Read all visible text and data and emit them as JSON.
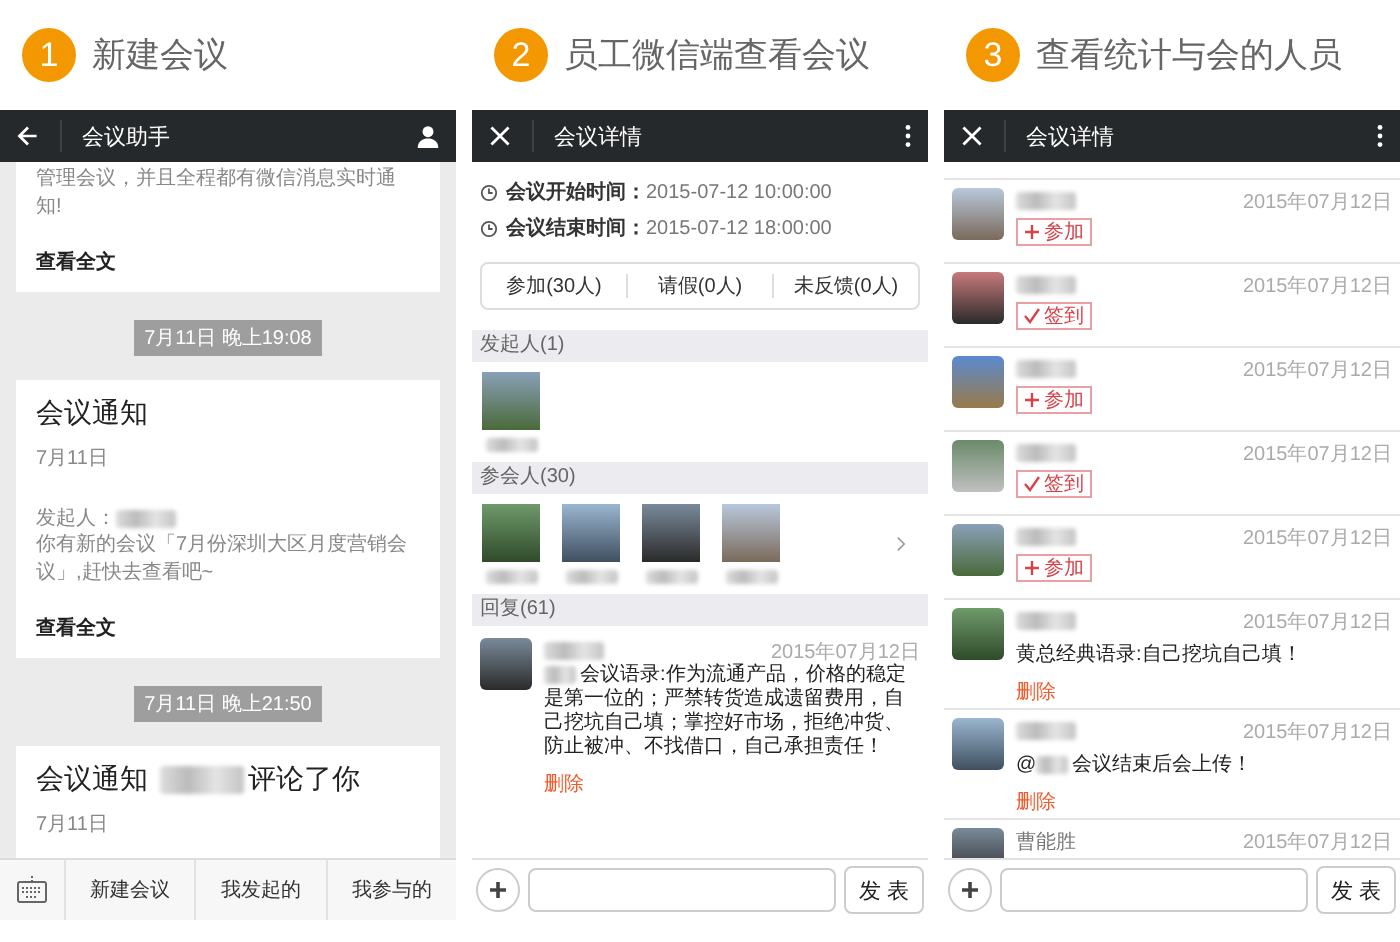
{
  "steps": [
    {
      "number": "1",
      "title": "新建会议"
    },
    {
      "number": "2",
      "title": "员工微信端查看会议"
    },
    {
      "number": "3",
      "title": "查看统计与会的人员"
    }
  ],
  "panel_1": {
    "header": {
      "title": "会议助手"
    },
    "feed": [
      {
        "kind": "card",
        "body": "管理会议，并且全程都有微信消息实时通知!",
        "link": "查看全文"
      },
      {
        "kind": "time",
        "text": "7月11日 晚上19:08"
      },
      {
        "kind": "card",
        "title": "会议通知",
        "date": "7月11日",
        "sender_label": "发起人：",
        "body": "你有新的会议「7月份深圳大区月度营销会议」,赶快去查看吧~",
        "link": "查看全文"
      },
      {
        "kind": "time",
        "text": "7月11日 晚上21:50"
      },
      {
        "kind": "card",
        "title": "会议通知",
        "title_suffix": "评论了你",
        "date": "7月11日"
      }
    ],
    "menu": [
      "新建会议",
      "我发起的",
      "我参与的"
    ]
  },
  "panel_2": {
    "header": {
      "title": "会议详情"
    },
    "times": [
      {
        "label": "会议开始时间：",
        "value": "2015-07-12 10:00:00"
      },
      {
        "label": "会议结束时间：",
        "value": "2015-07-12 18:00:00"
      }
    ],
    "response_counts": [
      "参加(30人)",
      "请假(0人)",
      "未反馈(0人)"
    ],
    "organizer_heading": "发起人(1)",
    "attendees_heading": "参会人(30)",
    "replies": {
      "heading": "回复(61)",
      "items": [
        {
          "date": "2015年07月12日",
          "text": "会议语录:作为流通产品，价格的稳定是第一位的；严禁转货造成遗留费用，自己挖坑自己填；掌控好市场，拒绝冲货、防止被冲、不找借口，自己承担责任！",
          "action": "删除"
        }
      ]
    },
    "composer": {
      "button": "发 表"
    }
  },
  "panel_3": {
    "header": {
      "title": "会议详情"
    },
    "entries": [
      {
        "kind": "join",
        "label": "参加",
        "date": "2015年07月12日"
      },
      {
        "kind": "checkin",
        "label": "签到",
        "date": "2015年07月12日"
      },
      {
        "kind": "join",
        "label": "参加",
        "date": "2015年07月12日"
      },
      {
        "kind": "checkin",
        "label": "签到",
        "date": "2015年07月12日"
      },
      {
        "kind": "join",
        "label": "参加",
        "date": "2015年07月12日"
      },
      {
        "kind": "comment",
        "text": "黄总经典语录:自己挖坑自己填！",
        "action": "删除",
        "date": "2015年07月12日"
      },
      {
        "kind": "comment",
        "mention": "@",
        "text": "会议结束后会上传！",
        "action": "删除",
        "date": "2015年07月12日"
      },
      {
        "kind": "name_only",
        "name": "曹能胜",
        "date": "2015年07月12日"
      }
    ],
    "composer": {
      "button": "发 表"
    }
  }
}
